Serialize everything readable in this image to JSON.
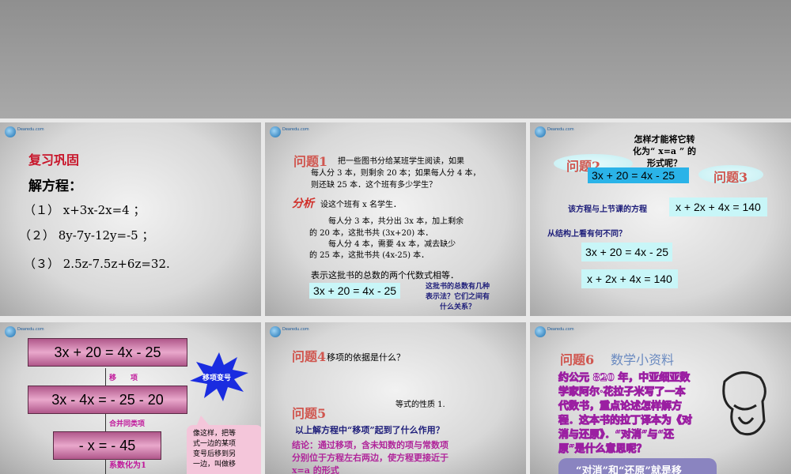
{
  "logo_text": "Dearedu.com",
  "s1": {
    "title": "复习巩固",
    "subtitle": "解方程：",
    "items": [
      "（１） x+3x-2x=4 ；",
      "（２） 8y-7y-12y=-5 ；",
      "（３） 2.5z-7.5z+6z=32."
    ]
  },
  "s2": {
    "q": "问题1",
    "problem": [
      "把一些图书分给某班学生阅读，如果",
      "每人分 3 本，则剩余 20 本；如果每人分 4 本，",
      "则还缺 25 本．这个班有多少学生？"
    ],
    "analysis_label": "分析",
    "analysis": "设这个班有 x 名学生．",
    "lines": [
      "每人分 3 本，共分出 3x 本，加上剩余",
      "的 20 本，这批书共 (3x+20) 本．",
      "每人分 4 本，需要 4x 本，减去缺少",
      "的 25 本，这批书共 (4x-25) 本．"
    ],
    "conclusion": "表示这批书的总数的两个代数式相等．",
    "equation": "3x + 20 = 4x - 25",
    "note": [
      "这批书的总数有几种",
      "表示法？它们之间有",
      "什么关系？"
    ]
  },
  "s3": {
    "question": [
      "怎样才能将它转",
      "化为“ x=a ” 的",
      "形式呢？"
    ],
    "q2": "问题2",
    "q3": "问题3",
    "equation": "3x + 20 = 4x - 25",
    "compare": "该方程与上节课的方程",
    "eq2": "x + 2x + 4x = 140",
    "ask": "从结构上看有何不同？",
    "eq_a": "3x + 20 = 4x - 25",
    "eq_b": "x + 2x + 4x = 140"
  },
  "s4": {
    "steps": [
      "3x + 20 = 4x - 25",
      "3x - 4x = - 25 - 20",
      "- x = - 45"
    ],
    "labels": [
      "移　　项",
      "合并同类项",
      "系数化为1"
    ],
    "burst": "移项变号",
    "bubble": [
      "像这样，把等",
      "式一边的某项",
      "变号后移到另",
      "一边，叫做移"
    ]
  },
  "s5": {
    "q4": "问题4",
    "q4_text": "移项的依据是什么？",
    "answer": "等式的性质 1.",
    "q5": "问题5",
    "q5_text": "以上解方程中“移项”起到了什么作用？",
    "conclusion": [
      "结论：通过移项，含未知数的项与常数项",
      "分别位于方程左右两边，使方程更接近于",
      "x=a 的形式"
    ]
  },
  "s6": {
    "q": "问题6",
    "title": "数学小资料",
    "text": [
      "约公元 820 年，中亚细亚数",
      "学家阿尔·花拉子米写了一本",
      "代数书，重点论述怎样解方",
      "程．这本书的拉丁译本为《对",
      "消与还原》．“对消”与“还",
      "原”是什么意思呢？"
    ],
    "box": "“对消”和“还原”就是移"
  }
}
